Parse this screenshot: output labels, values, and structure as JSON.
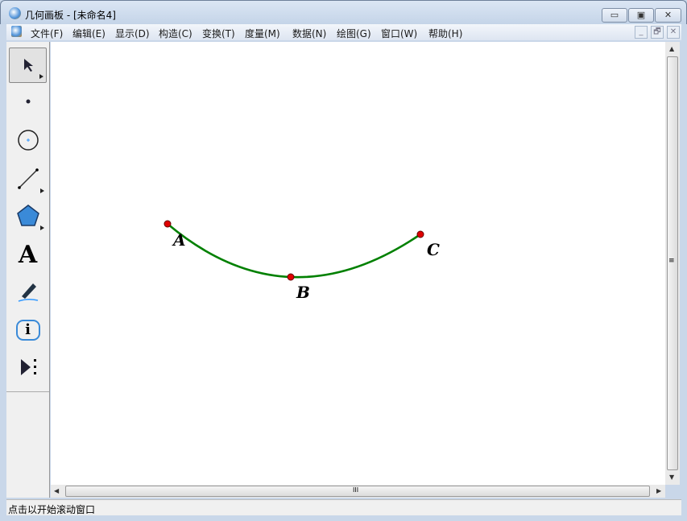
{
  "window": {
    "title": "几何画板 - [未命名4]",
    "minimize": "▭",
    "maximize": "▣",
    "close": "✕"
  },
  "menu": [
    "文件(F)",
    "编辑(E)",
    "显示(D)",
    "构造(C)",
    "变换(T)",
    "度量(M)",
    "数据(N)",
    "绘图(G)",
    "窗口(W)",
    "帮助(H)"
  ],
  "mdi": {
    "minimize": "_",
    "restore": "🗗",
    "close": "✕"
  },
  "tools": [
    "arrow-select-tool",
    "point-tool",
    "compass-tool",
    "straightedge-tool",
    "polygon-tool",
    "text-tool",
    "marker-tool",
    "information-tool",
    "custom-tool"
  ],
  "text_tool_glyph": "A",
  "info_glyph": "i",
  "points": {
    "A": "A",
    "B": "B",
    "C": "C"
  },
  "colors": {
    "arc": "#008000",
    "point": "#e00000"
  },
  "hscroll_grip": "III",
  "vscroll_grip": "≡",
  "status": "点击以开始滚动窗口"
}
